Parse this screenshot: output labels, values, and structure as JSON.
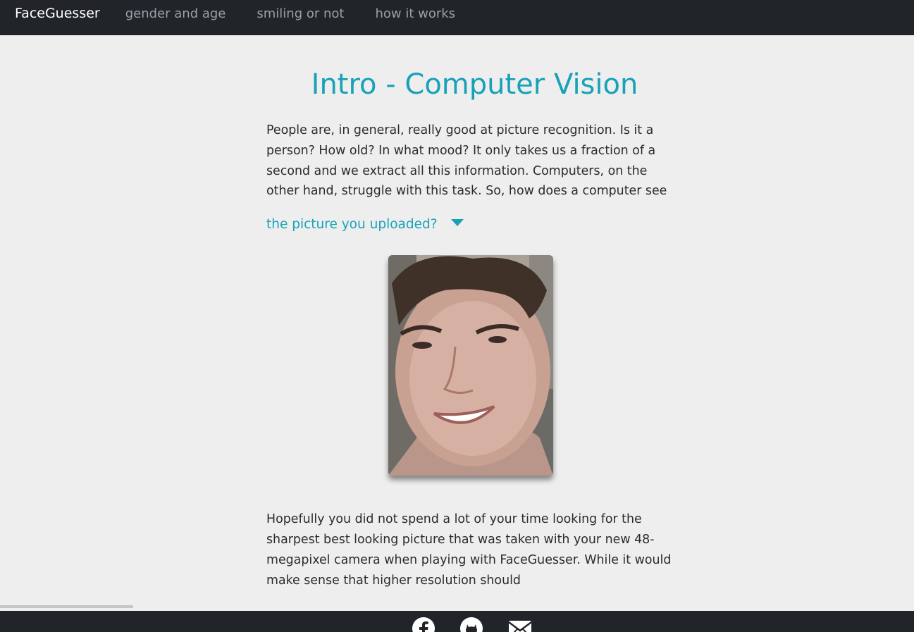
{
  "nav": {
    "brand": "FaceGuesser",
    "links": [
      "gender and age",
      "smiling or not",
      "how it works"
    ]
  },
  "main": {
    "title": "Intro - Computer Vision",
    "intro_paragraph": "People are, in general, really good at picture recognition. Is it a person? How old? In what mood? It only takes us a fraction of a second and we extract all this information. Computers, on the other hand, struggle with this task. So, how does a computer see",
    "toggle_label": "the picture you uploaded?",
    "second_paragraph": "Hopefully you did not spend a lot of your time looking for the sharpest best looking picture that was taken with your new 48-megapixel camera when playing with FaceGuesser. While it would make sense that higher resolution should"
  },
  "footer": {
    "icons": [
      "facebook-icon",
      "github-icon",
      "mail-icon"
    ]
  },
  "colors": {
    "nav_bg": "#212529",
    "accent": "#17a2b8",
    "page_bg": "#eeeeee"
  }
}
